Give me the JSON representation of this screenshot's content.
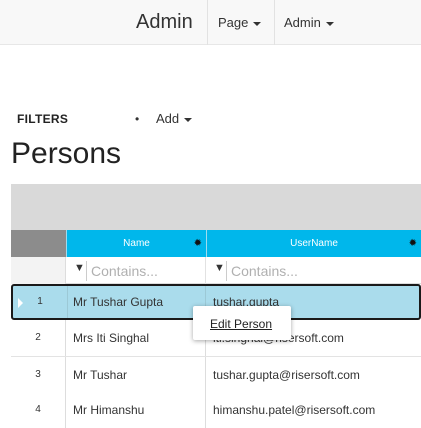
{
  "navbar": {
    "brand": "Admin",
    "page_menu": "Page",
    "admin_menu": "Admin"
  },
  "toolbar": {
    "filters_label": "FILTERS",
    "add_menu": "Add"
  },
  "page_title": "Persons",
  "grid": {
    "columns": [
      "Name",
      "UserName"
    ],
    "filter_placeholder": "Contains...",
    "rows": [
      {
        "num": "1",
        "name": "Mr Tushar Gupta",
        "username": "tushar.gupta",
        "selected": true
      },
      {
        "num": "2",
        "name": "Mrs Iti Singhal",
        "username": "iti.singhal@risersoft.com"
      },
      {
        "num": "3",
        "name": "Mr Tushar",
        "username": "tushar.gupta@risersoft.com"
      },
      {
        "num": "4",
        "name": "Mr Himanshu",
        "username": "himanshu.patel@risersoft.com"
      }
    ]
  },
  "context_menu": {
    "items": [
      "Edit Person"
    ]
  },
  "colors": {
    "header_bg": "#00b7eb",
    "selected_row": "#aadcec"
  }
}
